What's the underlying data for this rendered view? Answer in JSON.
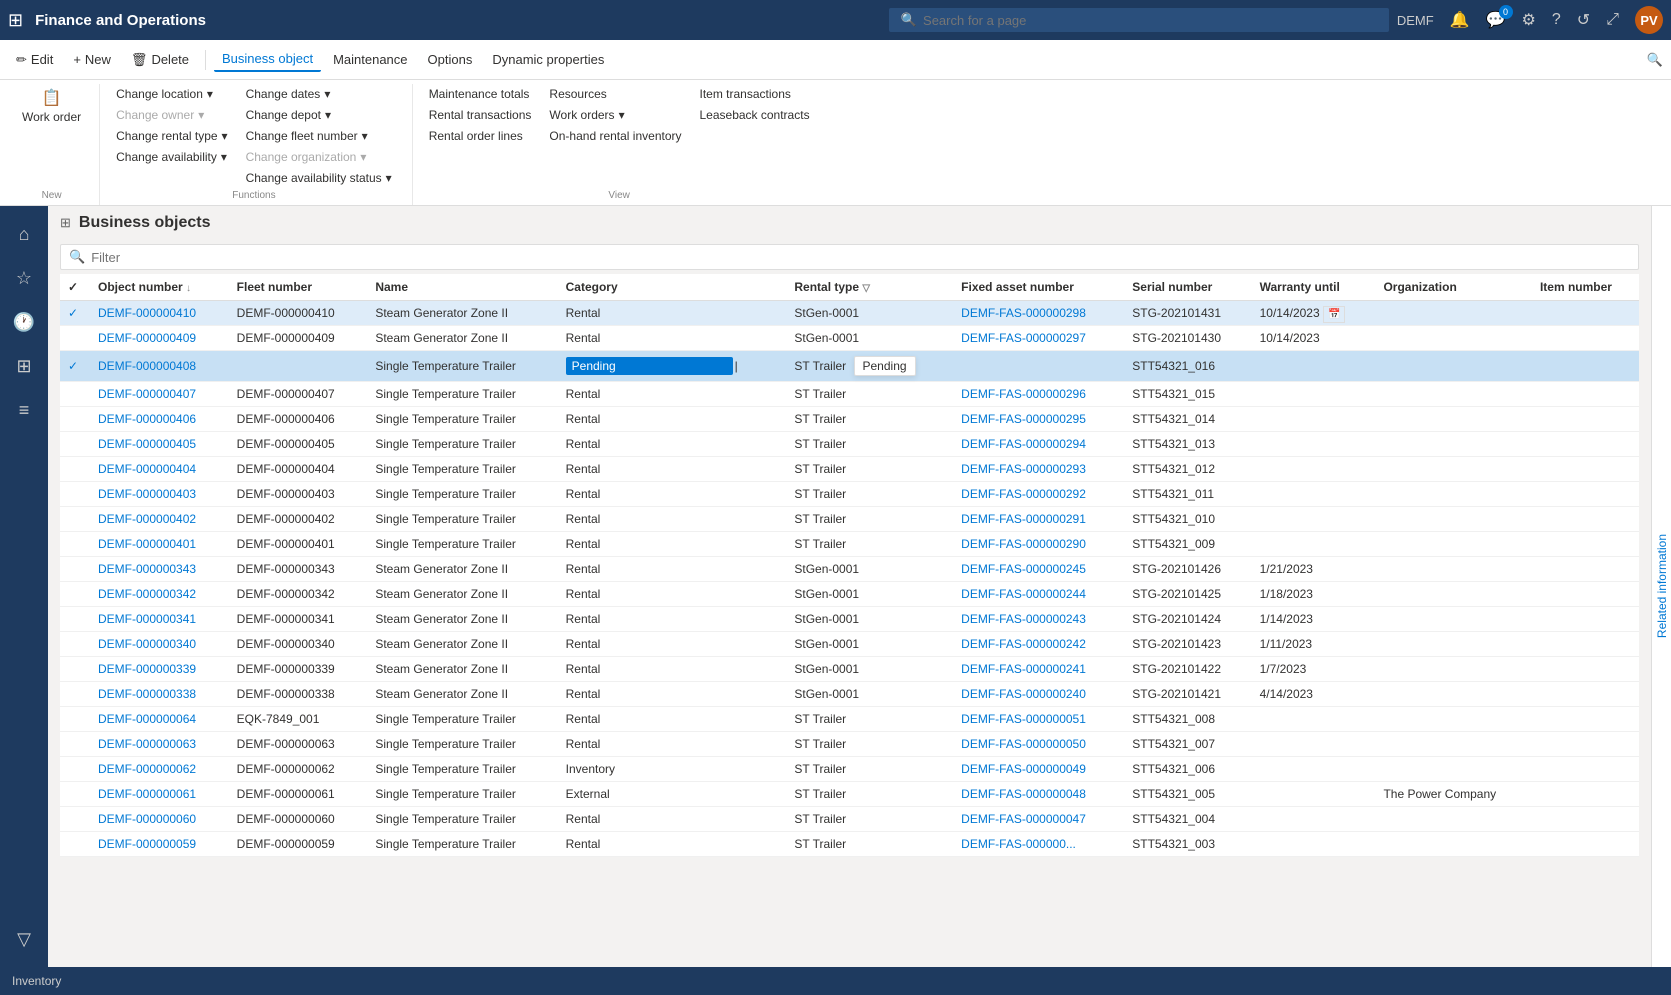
{
  "topNav": {
    "appIcon": "⊞",
    "appTitle": "Finance and Operations",
    "searchPlaceholder": "Search for a page",
    "user": "DEMF",
    "avatarText": "PV"
  },
  "toolbar": {
    "editLabel": "Edit",
    "newLabel": "New",
    "deleteLabel": "Delete",
    "businessObjectLabel": "Business object",
    "maintenanceLabel": "Maintenance",
    "optionsLabel": "Options",
    "dynamicPropertiesLabel": "Dynamic properties"
  },
  "ribbon": {
    "groups": {
      "new": {
        "label": "New",
        "items": [
          {
            "label": "Work order"
          }
        ]
      },
      "functions": {
        "label": "Functions",
        "items": [
          {
            "label": "Change location",
            "hasDropdown": true
          },
          {
            "label": "Change owner",
            "hasDropdown": true,
            "disabled": true
          },
          {
            "label": "Change rental type",
            "hasDropdown": true
          },
          {
            "label": "Change availability",
            "hasDropdown": true
          },
          {
            "label": "Change dates",
            "hasDropdown": true
          },
          {
            "label": "Change depot",
            "hasDropdown": true
          },
          {
            "label": "Change fleet number",
            "hasDropdown": true
          },
          {
            "label": "Change organization",
            "hasDropdown": true,
            "disabled": true
          },
          {
            "label": "Change availability status",
            "hasDropdown": true
          }
        ]
      },
      "view": {
        "label": "View",
        "items": [
          {
            "label": "Maintenance totals"
          },
          {
            "label": "Rental transactions"
          },
          {
            "label": "Rental order lines"
          },
          {
            "label": "Resources"
          },
          {
            "label": "Work orders",
            "hasDropdown": true
          },
          {
            "label": "On-hand rental inventory"
          },
          {
            "label": "Item transactions"
          },
          {
            "label": "Leaseback contracts"
          }
        ]
      }
    }
  },
  "leftSidebar": {
    "icons": [
      {
        "name": "home-icon",
        "symbol": "⌂"
      },
      {
        "name": "star-icon",
        "symbol": "☆"
      },
      {
        "name": "recent-icon",
        "symbol": "🕐"
      },
      {
        "name": "list-icon",
        "symbol": "≡"
      },
      {
        "name": "filter-icon",
        "symbol": "▽"
      }
    ]
  },
  "businessObjects": {
    "title": "Business objects",
    "filterPlaceholder": "Filter",
    "columns": [
      {
        "key": "objectNumber",
        "label": "Object number",
        "sortable": true
      },
      {
        "key": "fleetNumber",
        "label": "Fleet number"
      },
      {
        "key": "name",
        "label": "Name"
      },
      {
        "key": "category",
        "label": "Category"
      },
      {
        "key": "rentalType",
        "label": "Rental type",
        "filterable": true
      },
      {
        "key": "fixedAssetNumber",
        "label": "Fixed asset number"
      },
      {
        "key": "serialNumber",
        "label": "Serial number"
      },
      {
        "key": "warrantyUntil",
        "label": "Warranty until"
      },
      {
        "key": "organization",
        "label": "Organization"
      },
      {
        "key": "itemNumber",
        "label": "Item number"
      }
    ],
    "rows": [
      {
        "id": "r1",
        "objectNumber": "DEMF-000000410",
        "fleetNumber": "DEMF-000000410",
        "name": "Steam Generator Zone II",
        "category": "Rental",
        "rentalType": "StGen-0001",
        "fixedAssetNumber": "DEMF-FAS-000000298",
        "serialNumber": "STG-202101431",
        "warrantyUntil": "10/14/2023",
        "organization": "",
        "itemNumber": "",
        "selected": true,
        "active": false
      },
      {
        "id": "r2",
        "objectNumber": "DEMF-000000409",
        "fleetNumber": "DEMF-000000409",
        "name": "Steam Generator Zone II",
        "category": "Rental",
        "rentalType": "StGen-0001",
        "fixedAssetNumber": "DEMF-FAS-000000297",
        "serialNumber": "STG-202101430",
        "warrantyUntil": "10/14/2023",
        "organization": "",
        "itemNumber": "",
        "selected": false
      },
      {
        "id": "r3",
        "objectNumber": "DEMF-000000408",
        "fleetNumber": "",
        "name": "Single Temperature Trailer",
        "category": "Pending",
        "rentalType": "ST Trailer",
        "fixedAssetNumber": "",
        "serialNumber": "STT54321_016",
        "warrantyUntil": "",
        "organization": "",
        "itemNumber": "",
        "selected": true,
        "active": true,
        "pendingEdit": true,
        "pendingTooltip": "Pending"
      },
      {
        "id": "r4",
        "objectNumber": "DEMF-000000407",
        "fleetNumber": "DEMF-000000407",
        "name": "Single Temperature Trailer",
        "category": "Rental",
        "rentalType": "ST Trailer",
        "fixedAssetNumber": "DEMF-FAS-000000296",
        "serialNumber": "STT54321_015",
        "warrantyUntil": "",
        "organization": "",
        "itemNumber": ""
      },
      {
        "id": "r5",
        "objectNumber": "DEMF-000000406",
        "fleetNumber": "DEMF-000000406",
        "name": "Single Temperature Trailer",
        "category": "Rental",
        "rentalType": "ST Trailer",
        "fixedAssetNumber": "DEMF-FAS-000000295",
        "serialNumber": "STT54321_014",
        "warrantyUntil": "",
        "organization": "",
        "itemNumber": ""
      },
      {
        "id": "r6",
        "objectNumber": "DEMF-000000405",
        "fleetNumber": "DEMF-000000405",
        "name": "Single Temperature Trailer",
        "category": "Rental",
        "rentalType": "ST Trailer",
        "fixedAssetNumber": "DEMF-FAS-000000294",
        "serialNumber": "STT54321_013",
        "warrantyUntil": "",
        "organization": "",
        "itemNumber": ""
      },
      {
        "id": "r7",
        "objectNumber": "DEMF-000000404",
        "fleetNumber": "DEMF-000000404",
        "name": "Single Temperature Trailer",
        "category": "Rental",
        "rentalType": "ST Trailer",
        "fixedAssetNumber": "DEMF-FAS-000000293",
        "serialNumber": "STT54321_012",
        "warrantyUntil": "",
        "organization": "",
        "itemNumber": ""
      },
      {
        "id": "r8",
        "objectNumber": "DEMF-000000403",
        "fleetNumber": "DEMF-000000403",
        "name": "Single Temperature Trailer",
        "category": "Rental",
        "rentalType": "ST Trailer",
        "fixedAssetNumber": "DEMF-FAS-000000292",
        "serialNumber": "STT54321_011",
        "warrantyUntil": "",
        "organization": "",
        "itemNumber": ""
      },
      {
        "id": "r9",
        "objectNumber": "DEMF-000000402",
        "fleetNumber": "DEMF-000000402",
        "name": "Single Temperature Trailer",
        "category": "Rental",
        "rentalType": "ST Trailer",
        "fixedAssetNumber": "DEMF-FAS-000000291",
        "serialNumber": "STT54321_010",
        "warrantyUntil": "",
        "organization": "",
        "itemNumber": ""
      },
      {
        "id": "r10",
        "objectNumber": "DEMF-000000401",
        "fleetNumber": "DEMF-000000401",
        "name": "Single Temperature Trailer",
        "category": "Rental",
        "rentalType": "ST Trailer",
        "fixedAssetNumber": "DEMF-FAS-000000290",
        "serialNumber": "STT54321_009",
        "warrantyUntil": "",
        "organization": "",
        "itemNumber": ""
      },
      {
        "id": "r11",
        "objectNumber": "DEMF-000000343",
        "fleetNumber": "DEMF-000000343",
        "name": "Steam Generator Zone II",
        "category": "Rental",
        "rentalType": "StGen-0001",
        "fixedAssetNumber": "DEMF-FAS-000000245",
        "serialNumber": "STG-202101426",
        "warrantyUntil": "1/21/2023",
        "organization": "",
        "itemNumber": ""
      },
      {
        "id": "r12",
        "objectNumber": "DEMF-000000342",
        "fleetNumber": "DEMF-000000342",
        "name": "Steam Generator Zone II",
        "category": "Rental",
        "rentalType": "StGen-0001",
        "fixedAssetNumber": "DEMF-FAS-000000244",
        "serialNumber": "STG-202101425",
        "warrantyUntil": "1/18/2023",
        "organization": "",
        "itemNumber": ""
      },
      {
        "id": "r13",
        "objectNumber": "DEMF-000000341",
        "fleetNumber": "DEMF-000000341",
        "name": "Steam Generator Zone II",
        "category": "Rental",
        "rentalType": "StGen-0001",
        "fixedAssetNumber": "DEMF-FAS-000000243",
        "serialNumber": "STG-202101424",
        "warrantyUntil": "1/14/2023",
        "organization": "",
        "itemNumber": ""
      },
      {
        "id": "r14",
        "objectNumber": "DEMF-000000340",
        "fleetNumber": "DEMF-000000340",
        "name": "Steam Generator Zone II",
        "category": "Rental",
        "rentalType": "StGen-0001",
        "fixedAssetNumber": "DEMF-FAS-000000242",
        "serialNumber": "STG-202101423",
        "warrantyUntil": "1/11/2023",
        "organization": "",
        "itemNumber": ""
      },
      {
        "id": "r15",
        "objectNumber": "DEMF-000000339",
        "fleetNumber": "DEMF-000000339",
        "name": "Steam Generator Zone II",
        "category": "Rental",
        "rentalType": "StGen-0001",
        "fixedAssetNumber": "DEMF-FAS-000000241",
        "serialNumber": "STG-202101422",
        "warrantyUntil": "1/7/2023",
        "organization": "",
        "itemNumber": ""
      },
      {
        "id": "r16",
        "objectNumber": "DEMF-000000338",
        "fleetNumber": "DEMF-000000338",
        "name": "Steam Generator Zone II",
        "category": "Rental",
        "rentalType": "StGen-0001",
        "fixedAssetNumber": "DEMF-FAS-000000240",
        "serialNumber": "STG-202101421",
        "warrantyUntil": "4/14/2023",
        "organization": "",
        "itemNumber": ""
      },
      {
        "id": "r17",
        "objectNumber": "DEMF-000000064",
        "fleetNumber": "EQK-7849_001",
        "name": "Single Temperature Trailer",
        "category": "Rental",
        "rentalType": "ST Trailer",
        "fixedAssetNumber": "DEMF-FAS-000000051",
        "serialNumber": "STT54321_008",
        "warrantyUntil": "",
        "organization": "",
        "itemNumber": ""
      },
      {
        "id": "r18",
        "objectNumber": "DEMF-000000063",
        "fleetNumber": "DEMF-000000063",
        "name": "Single Temperature Trailer",
        "category": "Rental",
        "rentalType": "ST Trailer",
        "fixedAssetNumber": "DEMF-FAS-000000050",
        "serialNumber": "STT54321_007",
        "warrantyUntil": "",
        "organization": "",
        "itemNumber": ""
      },
      {
        "id": "r19",
        "objectNumber": "DEMF-000000062",
        "fleetNumber": "DEMF-000000062",
        "name": "Single Temperature Trailer",
        "category": "Inventory",
        "rentalType": "ST Trailer",
        "fixedAssetNumber": "DEMF-FAS-000000049",
        "serialNumber": "STT54321_006",
        "warrantyUntil": "",
        "organization": "",
        "itemNumber": ""
      },
      {
        "id": "r20",
        "objectNumber": "DEMF-000000061",
        "fleetNumber": "DEMF-000000061",
        "name": "Single Temperature Trailer",
        "category": "External",
        "rentalType": "ST Trailer",
        "fixedAssetNumber": "DEMF-FAS-000000048",
        "serialNumber": "STT54321_005",
        "warrantyUntil": "",
        "organization": "The Power Company",
        "itemNumber": ""
      },
      {
        "id": "r21",
        "objectNumber": "DEMF-000000060",
        "fleetNumber": "DEMF-000000060",
        "name": "Single Temperature Trailer",
        "category": "Rental",
        "rentalType": "ST Trailer",
        "fixedAssetNumber": "DEMF-FAS-000000047",
        "serialNumber": "STT54321_004",
        "warrantyUntil": "",
        "organization": "",
        "itemNumber": ""
      },
      {
        "id": "r22",
        "objectNumber": "DEMF-000000059",
        "fleetNumber": "DEMF-000000059",
        "name": "Single Temperature Trailer",
        "category": "Rental",
        "rentalType": "ST Trailer",
        "fixedAssetNumber": "DEMF-FAS-000000...",
        "serialNumber": "STT54321_003",
        "warrantyUntil": "",
        "organization": "",
        "itemNumber": ""
      }
    ]
  },
  "statusBar": {
    "items": [
      "Inventory",
      "",
      "",
      ""
    ]
  },
  "rightPanel": {
    "label": "Related information"
  }
}
